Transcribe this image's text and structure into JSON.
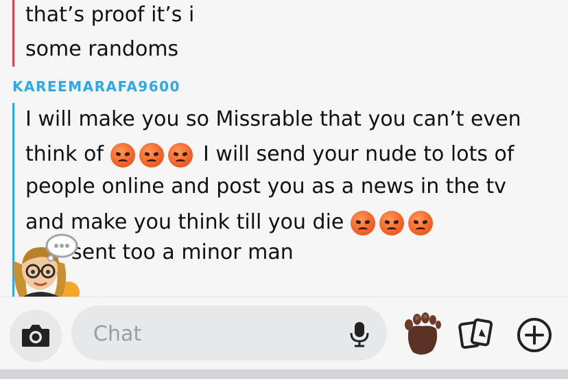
{
  "messages": {
    "prev_lines": [
      "that’s proof it’s i",
      "some randoms"
    ],
    "sender": "KAREEMARAFA9600",
    "line1": "I will make you so Missrable that you can’t even",
    "line2a": "think of",
    "line2b": "I will send your nude to lots of",
    "line3": "people online and post you as a news in the tv",
    "line4": "and make you think till you die",
    "line5": "sent too a minor man"
  },
  "composer": {
    "placeholder": "Chat"
  },
  "icons": {
    "camera": "camera-icon",
    "mic": "microphone-icon",
    "foot": "foot-emoji-icon",
    "cards": "cards-icon",
    "plus": "plus-circle-icon",
    "emoji": "angry-face-emoji"
  },
  "colors": {
    "my_bar": "#e63b55",
    "their_bar": "#2fa8e8",
    "sender_name": "#2fa8e8",
    "background": "#f6f6f6"
  }
}
